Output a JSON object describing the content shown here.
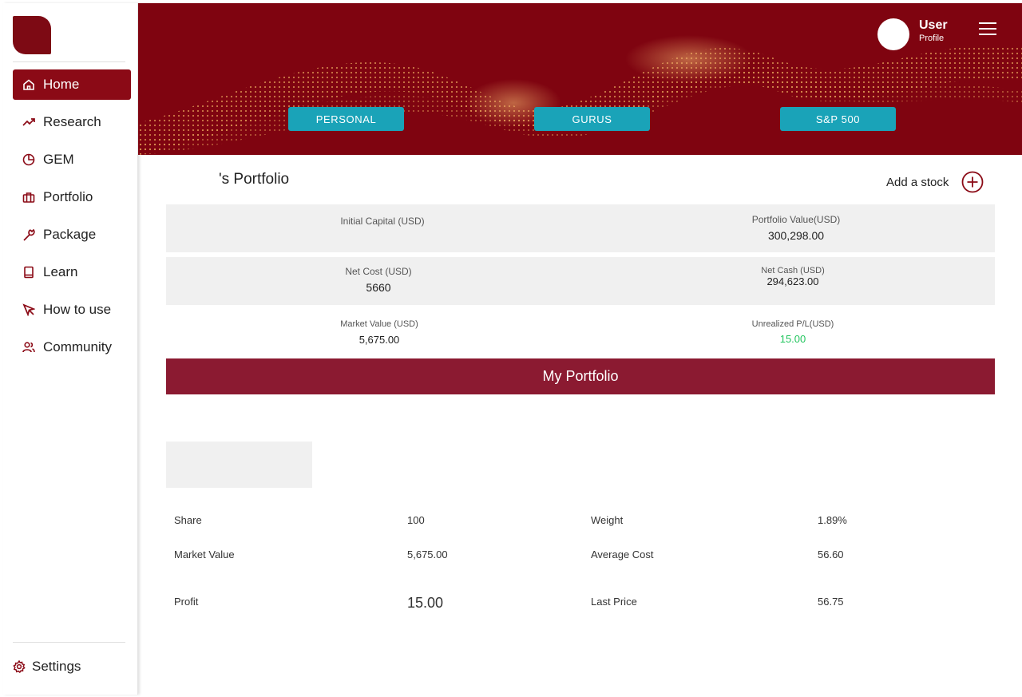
{
  "sidebar": {
    "items": [
      {
        "label": "Home",
        "icon": "home-icon",
        "active": true
      },
      {
        "label": "Research",
        "icon": "trending-up-icon",
        "active": false
      },
      {
        "label": "GEM",
        "icon": "pie-chart-icon",
        "active": false
      },
      {
        "label": "Portfolio",
        "icon": "briefcase-icon",
        "active": false
      },
      {
        "label": "Package",
        "icon": "wrench-icon",
        "active": false
      },
      {
        "label": "Learn",
        "icon": "book-icon",
        "active": false
      },
      {
        "label": "How to use",
        "icon": "cursor-icon",
        "active": false
      },
      {
        "label": "Community",
        "icon": "users-icon",
        "active": false
      }
    ],
    "settings_label": "Settings",
    "accent_color": "#8b0a16"
  },
  "banner": {
    "tabs": [
      "PERSONAL",
      "GURUS",
      "S&P 500"
    ],
    "user_name": "User",
    "user_sub": "Profile",
    "background_color": "#7f0410",
    "button_color": "#1aa3b8"
  },
  "portfolio": {
    "title": "'s Portfolio",
    "add_stock_label": "Add a stock",
    "summary": {
      "initial_capital_label": "Initial Capital (USD)",
      "initial_capital_value": "",
      "portfolio_value_label": "Portfolio Value(USD)",
      "portfolio_value": "300,298.00",
      "net_cost_label": "Net Cost (USD)",
      "net_cost_value": "5660",
      "net_cash_label": "Net Cash (USD)",
      "net_cash_value": "294,623.00",
      "market_value_label": "Market Value (USD)",
      "market_value": "5,675.00",
      "unrealized_label": "Unrealized P/L(USD)",
      "unrealized_value": "15.00"
    },
    "section_title": "My Portfolio",
    "details": {
      "share_label": "Share",
      "share_value": "100",
      "weight_label": "Weight",
      "weight_value": "1.89%",
      "market_value_label": "Market Value",
      "market_value": "5,675.00",
      "avg_cost_label": "Average Cost",
      "avg_cost_value": "56.60",
      "profit_label": "Profit",
      "profit_value": "15.00",
      "last_price_label": "Last Price",
      "last_price_value": "56.75"
    },
    "positive_color": "#22c55e"
  }
}
